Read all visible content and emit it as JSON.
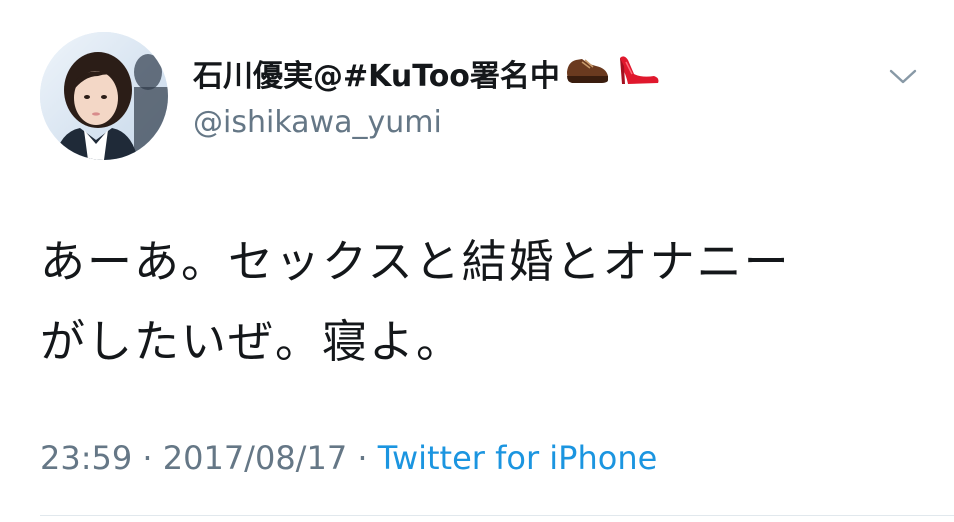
{
  "tweet": {
    "display_name": "石川優実@#KuToo署名中",
    "handle": "@ishikawa_yumi",
    "body_lines": [
      "あーあ。セックスと結婚とオナニー",
      "がしたいぜ。寝よ。"
    ],
    "time": "23:59",
    "separator1": " · ",
    "date": "2017/08/17",
    "separator2": " · ",
    "source": "Twitter for iPhone"
  },
  "icons": {
    "avatar": "profile-photo",
    "shoe1": "mans-shoe-icon",
    "shoe2": "high-heel-icon",
    "menu": "chevron-down-icon"
  },
  "colors": {
    "name": "#14171a",
    "secondary": "#657786",
    "link": "#1b95e0",
    "divider": "#e1e8ed"
  }
}
